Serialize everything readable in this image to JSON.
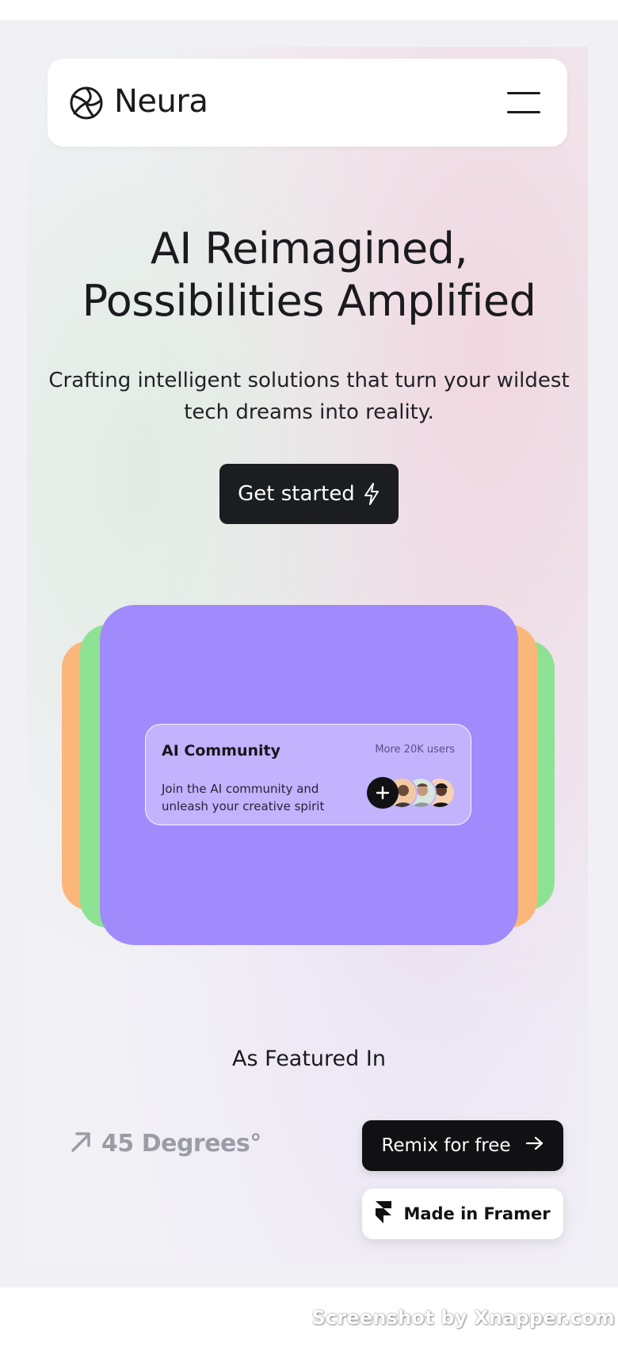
{
  "brand": {
    "name": "Neura",
    "logo_icon": "aperture-swirl-icon"
  },
  "nav": {
    "menu_icon": "hamburger-menu-icon"
  },
  "hero": {
    "headline": "AI Reimagined, Possibilities Amplified",
    "subline": "Crafting intelligent solutions that turn your wildest tech dreams into reality.",
    "cta_label": "Get started",
    "cta_icon": "lightning-bolt-icon"
  },
  "cards": {
    "colors": {
      "main": "#a18bfc",
      "orange": "#fbb679",
      "green": "#8ee294"
    },
    "community": {
      "title": "AI Community",
      "meta": "More 20K users",
      "description": "Join the AI community and unleash your creative spirit",
      "add_icon": "plus-icon",
      "avatars": [
        "avatar-1",
        "avatar-2",
        "avatar-3"
      ]
    }
  },
  "featured": {
    "heading": "As Featured In",
    "partners": [
      {
        "name": "45 Degrees°",
        "icon": "arrow-up-right-icon"
      }
    ]
  },
  "floating": {
    "remix_label": "Remix for free",
    "remix_icon": "arrow-right-icon",
    "framer_label": "Made in Framer",
    "framer_icon": "framer-logo-icon"
  },
  "watermark": {
    "text": "Screenshot by Xnapper.com"
  },
  "colors": {
    "dark": "#1c1d21",
    "muted_partner": "#9c9ca6",
    "page_bg": "#f1f0f5"
  }
}
